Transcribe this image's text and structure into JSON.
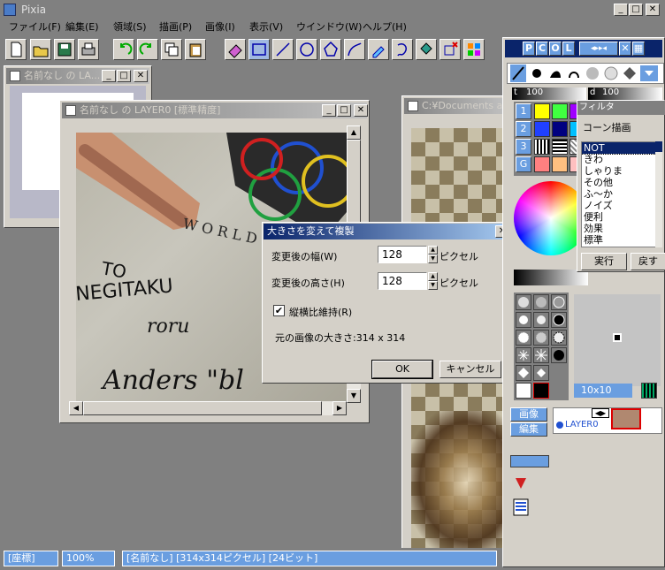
{
  "app": {
    "title": "Pixia"
  },
  "menu": [
    "ファイル(F)",
    "編集(E)",
    "領域(S)",
    "描画(P)",
    "画像(I)",
    "表示(V)",
    "ウインドウ(W)",
    "ヘルプ(H)"
  ],
  "windows": {
    "small": {
      "title": "名前なし の LA..."
    },
    "main": {
      "title": "名前なし の LAYER0 [標準精度]"
    },
    "right": {
      "title": "C:¥Documents and..."
    }
  },
  "dialog": {
    "title": "大きさを変えて複製",
    "width_label": "変更後の幅(W)",
    "width_value": "128",
    "height_label": "変更後の高さ(H)",
    "height_value": "128",
    "unit": "ピクセル",
    "keep_ratio_label": "縦横比維持(R)",
    "keep_ratio_checked": true,
    "original_size_label": "元の画像の大きさ:314 x 314",
    "ok": "OK",
    "cancel": "キャンセル"
  },
  "palette": {
    "mode_buttons": [
      "P",
      "C",
      "O",
      "L"
    ],
    "size_value": "100",
    "density_value": "100",
    "density_prefix": "d",
    "size_prefix": "t",
    "palette_rows": [
      "1",
      "2",
      "3",
      "G"
    ],
    "brush_size": "10x10"
  },
  "filter": {
    "title": "フィルタ",
    "heading": "コーン描画",
    "items": [
      "NOT",
      "きわ",
      "しゃりま",
      "その他",
      "ふ～か",
      "ノイズ",
      "便利",
      "効果",
      "標準"
    ],
    "selected": "NOT",
    "run_button": "実行",
    "back_button": "戻す"
  },
  "layer_panel": {
    "tab_image": "画像",
    "tab_edit": "編集",
    "layer_name": "LAYER0"
  },
  "statusbar": {
    "coords": "[座標]",
    "zoom": "100%",
    "info": "[名前なし] [314x314ピクセル] [24ビット]"
  },
  "colors": {
    "titlebar_active": "#0a246a",
    "status_blue": "#6a9ee0",
    "face": "#d4d0c8"
  }
}
